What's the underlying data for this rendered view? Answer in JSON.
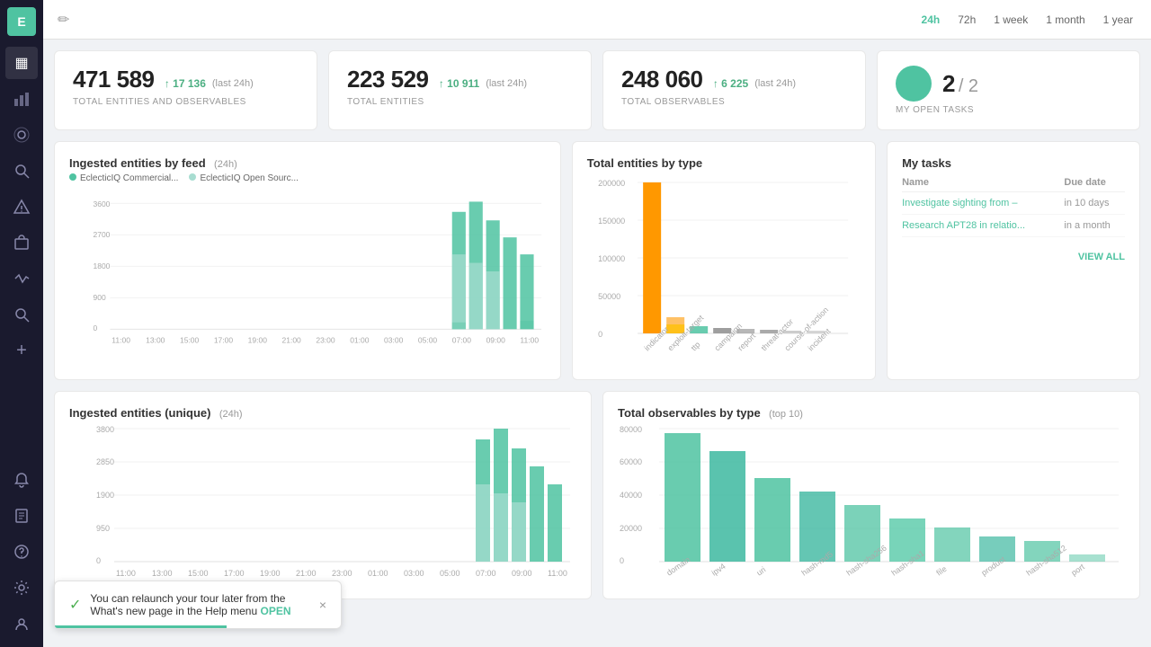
{
  "sidebar": {
    "logo_text": "E",
    "items": [
      {
        "name": "dashboard",
        "icon": "▦",
        "active": true
      },
      {
        "name": "analytics",
        "icon": "📊"
      },
      {
        "name": "network",
        "icon": "⬡"
      },
      {
        "name": "investigate",
        "icon": "🔍"
      },
      {
        "name": "alerts",
        "icon": "⚡"
      },
      {
        "name": "cases",
        "icon": "💼"
      },
      {
        "name": "activity",
        "icon": "✓"
      },
      {
        "name": "search",
        "icon": "🔎"
      },
      {
        "name": "add",
        "icon": "+"
      },
      {
        "name": "notifications",
        "icon": "🔔"
      },
      {
        "name": "reports",
        "icon": "📋"
      },
      {
        "name": "help",
        "icon": "?"
      },
      {
        "name": "settings",
        "icon": "⚙"
      },
      {
        "name": "profile",
        "icon": "👤"
      }
    ]
  },
  "header": {
    "edit_icon": "✏",
    "time_filters": [
      "24h",
      "72h",
      "1 week",
      "1 month",
      "1 year"
    ],
    "active_filter": "24h"
  },
  "stats": [
    {
      "number": "471 589",
      "change": "↑ 17 136",
      "last24": "(last 24h)",
      "label": "TOTAL ENTITIES AND OBSERVABLES"
    },
    {
      "number": "223 529",
      "change": "↑ 10 911",
      "last24": "(last 24h)",
      "label": "TOTAL ENTITIES"
    },
    {
      "number": "248 060",
      "change": "↑ 6 225",
      "last24": "(last 24h)",
      "label": "TOTAL OBSERVABLES"
    },
    {
      "task_current": "2",
      "task_total": "/ 2",
      "label": "MY OPEN TASKS"
    }
  ],
  "ingested_feed_chart": {
    "title": "Ingested entities by feed",
    "subtitle": "(24h)",
    "legend": [
      "EclecticIQ Commercial...",
      "EclecticIQ Open Sourc..."
    ],
    "y_labels": [
      "3600",
      "2700",
      "1800",
      "900",
      "0"
    ],
    "x_labels": [
      "11:00",
      "13:00",
      "15:00",
      "17:00",
      "19:00",
      "21:00",
      "23:00",
      "01:00",
      "03:00",
      "05:00",
      "07:00",
      "09:00",
      "11:00"
    ]
  },
  "total_by_type_chart": {
    "title": "Total entities by type",
    "y_labels": [
      "200000",
      "150000",
      "100000",
      "50000",
      "0"
    ],
    "x_labels": [
      "indicator",
      "exploit-target",
      "ttp",
      "campaign",
      "report",
      "threat-actor",
      "course-of-action",
      "incident"
    ]
  },
  "my_tasks": {
    "title": "My tasks",
    "columns": [
      "Name",
      "Due date"
    ],
    "tasks": [
      {
        "name": "Investigate sighting from –",
        "due": "in 10 days"
      },
      {
        "name": "Research APT28 in relatio...",
        "due": "in a month"
      }
    ],
    "view_all": "VIEW ALL"
  },
  "ingested_unique_chart": {
    "title": "Ingested entities (unique)",
    "subtitle": "(24h)",
    "y_labels": [
      "3800",
      "2850",
      "1900",
      "950",
      "0"
    ],
    "x_labels": [
      "11:00",
      "13:00",
      "15:00",
      "17:00",
      "19:00",
      "21:00",
      "23:00",
      "01:00",
      "03:00",
      "05:00",
      "07:00",
      "09:00",
      "11:00"
    ]
  },
  "observables_by_type_chart": {
    "title": "Total observables by type",
    "subtitle": "(top 10)",
    "y_labels": [
      "80000",
      "60000",
      "40000",
      "20000",
      "0"
    ],
    "x_labels": [
      "domain",
      "ipv4",
      "uri",
      "hash-md5",
      "hash-sha256",
      "hash-sha1",
      "file",
      "product",
      "hash-sha512",
      "port"
    ]
  },
  "toast": {
    "message": "You can relaunch your tour later from the\nWhat's new page in the Help menu",
    "link_text": "OPEN",
    "close": "×"
  }
}
